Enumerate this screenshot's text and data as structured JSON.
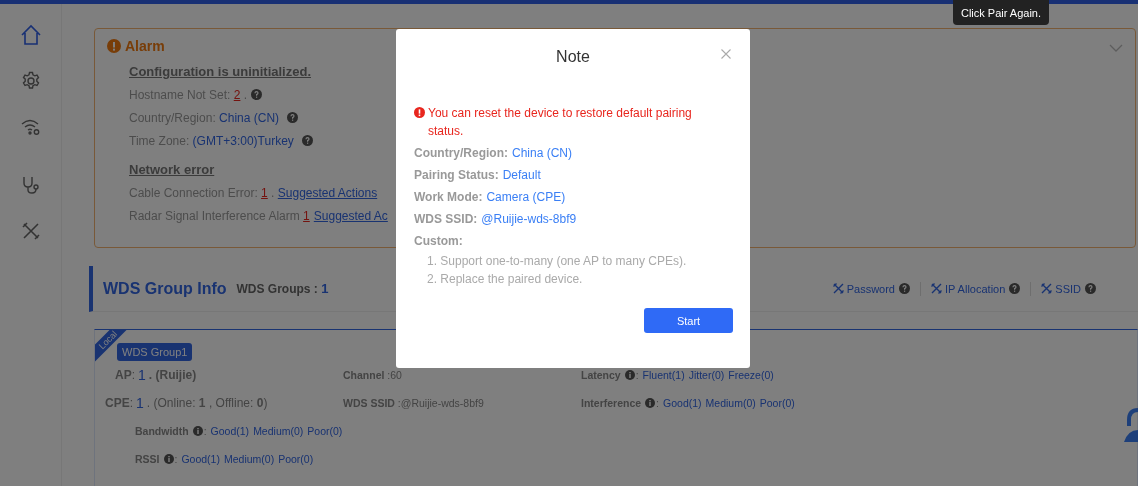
{
  "sidebar": {
    "items": [
      {
        "selected": true
      },
      {
        "selected": false
      },
      {
        "selected": false
      },
      {
        "selected": false
      },
      {
        "selected": false
      }
    ]
  },
  "alarm": {
    "title": "Alarm",
    "expanded": true,
    "sections": [
      {
        "heading": "Configuration is uninitialized.",
        "rows": [
          {
            "parts": [
              {
                "kind": "label",
                "text": "Hostname Not Set: "
              },
              {
                "kind": "count",
                "text": "2"
              },
              {
                "kind": "label",
                "text": " ."
              },
              {
                "kind": "help"
              }
            ]
          },
          {
            "parts": [
              {
                "kind": "label",
                "text": "Country/Region: "
              },
              {
                "kind": "value",
                "text": "China (CN)"
              },
              {
                "kind": "help"
              }
            ]
          },
          {
            "parts": [
              {
                "kind": "label",
                "text": "Time Zone: "
              },
              {
                "kind": "value",
                "text": "(GMT+3:00)Turkey"
              },
              {
                "kind": "help"
              }
            ]
          }
        ]
      },
      {
        "heading": "Network error",
        "rows": [
          {
            "parts": [
              {
                "kind": "label",
                "text": "Cable Connection Error: "
              },
              {
                "kind": "count",
                "text": "1"
              },
              {
                "kind": "label",
                "text": " . "
              },
              {
                "kind": "link",
                "text": "Suggested Actions"
              }
            ]
          },
          {
            "parts": [
              {
                "kind": "label",
                "text": "Radar Signal Interference Alarm "
              },
              {
                "kind": "count",
                "text": "1"
              },
              {
                "kind": "link",
                "text": "Suggested Ac"
              }
            ]
          }
        ]
      }
    ]
  },
  "wds": {
    "title": "WDS Group Info",
    "groups_label": "WDS Groups : ",
    "groups_count": "1",
    "actions": [
      {
        "label": "Password"
      },
      {
        "label": "IP Allocation"
      },
      {
        "label": "SSID"
      }
    ],
    "group": {
      "ribbon": "Local",
      "tag": "WDS Group1",
      "ap": {
        "label": "AP",
        "sep": ":",
        "count": "1",
        "detail": ". (Ruijie)"
      },
      "cpe": {
        "label": "CPE",
        "sep": ":",
        "count": "1",
        "detail": ". (Online: **1** , Offline: **0**)"
      },
      "channel": {
        "label": "Channel",
        "value": " :60"
      },
      "ssid": {
        "label": "WDS SSID",
        "value": " :@Ruijie-wds-8bf9"
      },
      "metrics": [
        {
          "label": "Latency",
          "suffix": ":",
          "options": [
            "Fluent(1)",
            "Jitter(0)",
            "Freeze(0)"
          ]
        },
        {
          "label": "Interference",
          "suffix": ":",
          "options": [
            "Good(1)",
            "Medium(0)",
            "Poor(0)"
          ]
        },
        {
          "label": "Bandwidth",
          "suffix": ":",
          "options": [
            "Good(1)",
            "Medium(0)",
            "Poor(0)"
          ]
        },
        {
          "label": "RSSI",
          "suffix": ":",
          "options": [
            "Good(1)",
            "Medium(0)",
            "Poor(0)"
          ]
        }
      ]
    }
  },
  "tooltip": "Click Pair Again.",
  "dialog": {
    "title": "Note",
    "warning": "You can reset the device to restore default pairing status.",
    "fields": [
      {
        "label": "Country/Region:",
        "value": "China (CN)"
      },
      {
        "label": "Pairing Status:",
        "value": "Default"
      },
      {
        "label": "Work Mode:",
        "value": "Camera (CPE)"
      },
      {
        "label": "WDS SSID:",
        "value": "@Ruijie-wds-8bf9"
      }
    ],
    "custom_label": "Custom:",
    "custom_items": [
      "1. Support one-to-many (one AP to many CPEs).",
      "2. Replace the paired device."
    ],
    "button": "Start"
  }
}
